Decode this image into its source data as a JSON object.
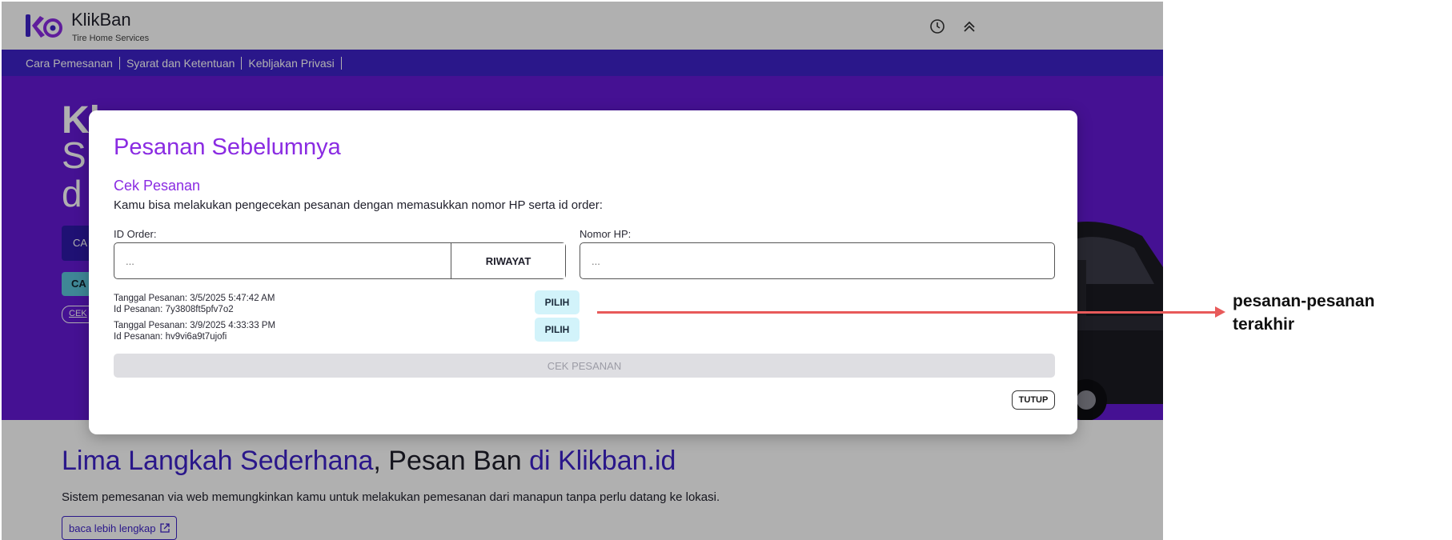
{
  "header": {
    "brand": "KlikBan",
    "tagline": "Tire Home Services",
    "icons": [
      "clock-icon",
      "chevrons-up-icon"
    ]
  },
  "nav": {
    "items": [
      {
        "label": "Cara Pemesanan"
      },
      {
        "label": "Syarat dan Ketentuan"
      },
      {
        "label": "Kebljakan Privasi"
      }
    ]
  },
  "hero": {
    "title_partial": "Kl",
    "line2_partial": "S",
    "line3_partial": "d",
    "button1_partial": "CA",
    "button2_partial": "CA",
    "button3_partial": "CEK"
  },
  "modal": {
    "title": "Pesanan Sebelumnya",
    "subtitle": "Cek Pesanan",
    "description": "Kamu bisa melakukan pengecekan pesanan dengan memasukkan nomor HP serta id order:",
    "id_order": {
      "label": "ID Order:",
      "placeholder": "..."
    },
    "riwayat_label": "RIWAYAT",
    "nomor_hp": {
      "label": "Nomor HP:",
      "placeholder": "..."
    },
    "orders": [
      {
        "tanggal": "Tanggal Pesanan: 3/5/2025 5:47:42 AM",
        "id": "Id Pesanan: 7y3808ft5pfv7o2",
        "action": "PILIH"
      },
      {
        "tanggal": "Tanggal Pesanan: 3/9/2025 4:33:33 PM",
        "id": "Id Pesanan: hv9vi6a9t7ujofi",
        "action": "PILIH"
      }
    ],
    "cek_label": "CEK PESANAN",
    "close_label": "TUTUP"
  },
  "steps": {
    "title_part1": "Lima Langkah Sederhana",
    "title_part2": ", Pesan Ban ",
    "title_part3": "di Klikban.id",
    "subtitle": "Sistem pemesanan via web memungkinkan kamu untuk melakukan pemesanan dari manapun tanpa perlu datang ke lokasi.",
    "link_label": "baca lebih lengkap",
    "link_icon": "external-link-icon"
  },
  "annotation": {
    "line1": "pesanan-pesanan",
    "line2": "terakhir",
    "color": "#e85a5a"
  },
  "colors": {
    "primary": "#3d22c9",
    "hero_bg": "#6419d6",
    "modal_accent": "#8a2be2",
    "pilih_bg": "#d2f3fa"
  }
}
